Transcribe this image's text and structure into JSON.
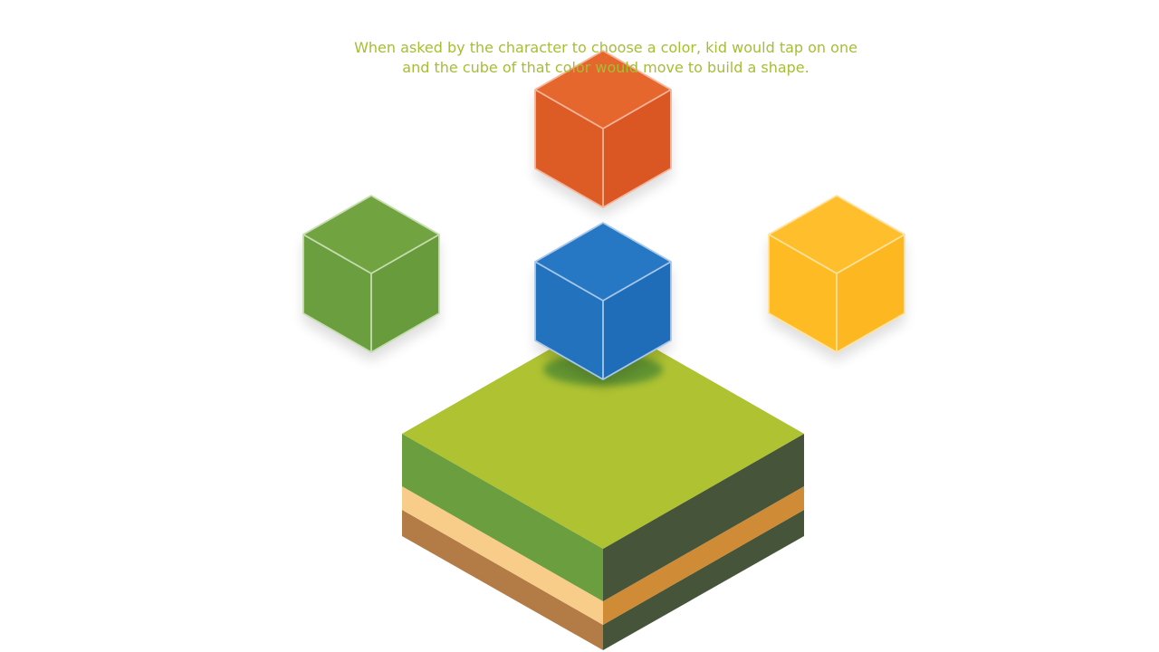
{
  "instructions": {
    "line1": "When asked by the character to choose a color, kid would tap on one",
    "line2": "and the cube of that color would move to build a shape.",
    "color": "#A6BE33"
  },
  "cubes": [
    {
      "id": "orange",
      "top": "#E6672E",
      "left": "#DD5B24",
      "right": "#DA5622",
      "edge": "#F6B59A"
    },
    {
      "id": "green",
      "top": "#71A441",
      "left": "#6A9E3E",
      "right": "#679B3C",
      "edge": "#C7DDB0"
    },
    {
      "id": "blue",
      "top": "#2778C4",
      "left": "#2272BE",
      "right": "#1F6DB9",
      "edge": "#A8C8EA"
    },
    {
      "id": "yellow",
      "top": "#FFBF2C",
      "left": "#FFBB23",
      "right": "#FDB720",
      "edge": "#FFE3A0"
    }
  ],
  "platform": {
    "grass_top": "#AFC232",
    "grass_left": "#6A9E3E",
    "dark_right": "#465539",
    "sand_left": "#F7CD89",
    "sand_right": "#D08B36",
    "soil_left": "#B37C46"
  }
}
